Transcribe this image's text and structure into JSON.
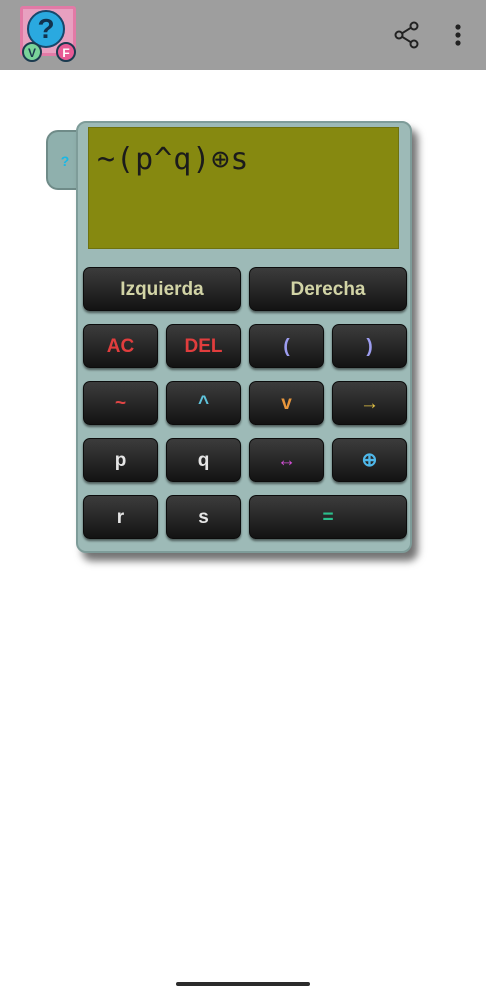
{
  "app_bar": {
    "logo": {
      "q": "?",
      "v": "V",
      "f": "F"
    },
    "share_icon": "share-icon",
    "more_icon": "more-vert-icon"
  },
  "calculator": {
    "help_tab": "?",
    "display": "~(p^q)⊕s",
    "keys": {
      "left": "Izquierda",
      "right": "Derecha",
      "ac": "AC",
      "del": "DEL",
      "open_paren": "(",
      "close_paren": ")",
      "not": "~",
      "and": "^",
      "or": "v",
      "implies": "→",
      "p": "p",
      "q": "q",
      "biconditional": "↔",
      "xor": "⊕",
      "r": "r",
      "s": "s",
      "equals": "="
    }
  }
}
